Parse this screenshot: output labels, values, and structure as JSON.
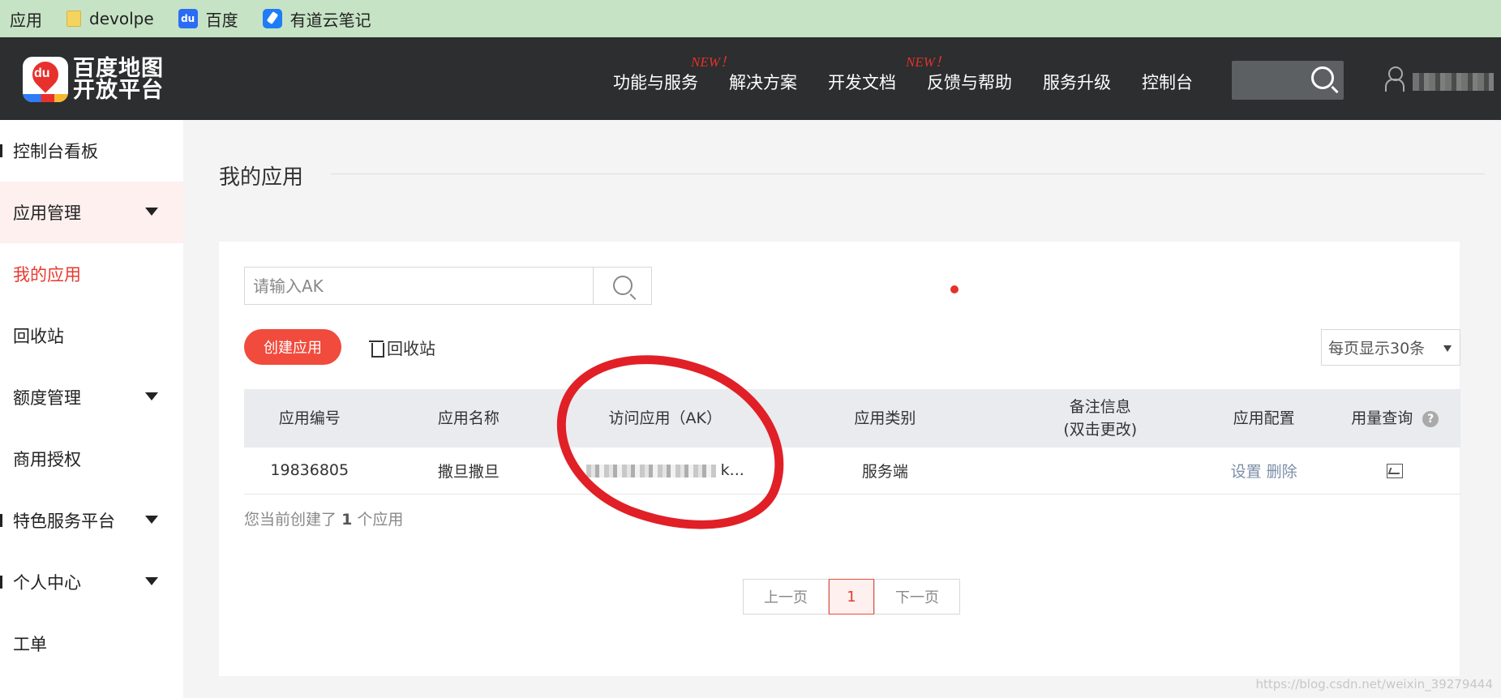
{
  "bookmarks": {
    "apps_label": "应用",
    "items": [
      {
        "label": "devolpe",
        "icon": "folder-icon"
      },
      {
        "label": "百度",
        "icon": "baidu-paw-icon"
      },
      {
        "label": "有道云笔记",
        "icon": "youdao-note-icon"
      }
    ]
  },
  "header": {
    "logo_line1": "百度地图",
    "logo_line2": "开放平台",
    "logo_badge": "du",
    "nav": [
      {
        "label": "功能与服务",
        "badge": "NEW！"
      },
      {
        "label": "解决方案"
      },
      {
        "label": "开发文档",
        "badge": "NEW！"
      },
      {
        "label": "反馈与帮助"
      },
      {
        "label": "服务升级"
      },
      {
        "label": "控制台"
      }
    ]
  },
  "sidebar": {
    "items": [
      {
        "label": "控制台看板"
      },
      {
        "label": "应用管理"
      },
      {
        "label": "我的应用"
      },
      {
        "label": "回收站"
      },
      {
        "label": "额度管理"
      },
      {
        "label": "商用授权"
      },
      {
        "label": "特色服务平台"
      },
      {
        "label": "个人中心"
      },
      {
        "label": "工单"
      }
    ]
  },
  "main": {
    "title": "我的应用",
    "search_placeholder": "请输入AK",
    "create_button": "创建应用",
    "recycle_link": "回收站",
    "per_page": "每页显示30条",
    "table": {
      "headers": [
        "应用编号",
        "应用名称",
        "访问应用（AK）",
        "应用类别",
        "备注信息",
        "(双击更改)",
        "应用配置",
        "用量查询"
      ],
      "rows": [
        {
          "id": "19836805",
          "name": "撒旦撒旦",
          "ak_suffix": "k...",
          "type": "服务端",
          "note": "",
          "action_settings": "设置",
          "action_delete": "删除"
        }
      ]
    },
    "count_prefix": "您当前创建了",
    "count_value": "1",
    "count_suffix": "个应用",
    "pagination": {
      "prev": "上一页",
      "current": "1",
      "next": "下一页"
    },
    "watermark": "https://blog.csdn.net/weixin_39279444"
  },
  "colors": {
    "accent": "#f04b3d",
    "header_bg": "#2c2e2f",
    "bookmarks_bg": "#c6e3c5",
    "annotation_red": "#e02026"
  }
}
